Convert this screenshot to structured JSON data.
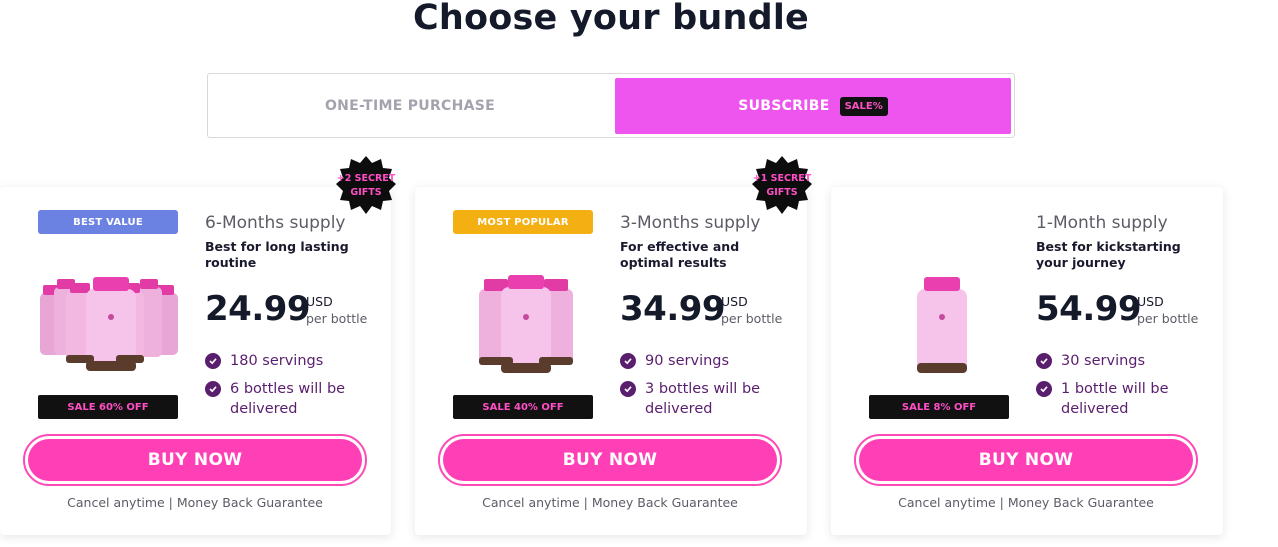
{
  "page": {
    "title": "Choose your bundle"
  },
  "toggle": {
    "one_time_label": "ONE-TIME PURCHASE",
    "subscribe_label": "SUBSCRIBE",
    "sale_badge": "SALE%"
  },
  "colors": {
    "accent_pink": "#ff3fb6",
    "subscribe_bg": "#ee55ee",
    "purple": "#5a1e6e",
    "best_value_blue": "#6b82e3",
    "most_popular_yellow": "#f4b012"
  },
  "bundles": [
    {
      "badge": "BEST VALUE",
      "gifts": "+2 SECRET GIFTS",
      "supply": "6-Months supply",
      "tagline": "Best for long lasting routine",
      "price": "24.99",
      "currency": "USD",
      "per": "per bottle",
      "features": [
        "180 servings",
        "6 bottles will be delivered"
      ],
      "sale": "SALE 60% OFF",
      "button": "BUY NOW",
      "guarantee": "Cancel anytime | Money Back Guarantee"
    },
    {
      "badge": "MOST POPULAR",
      "gifts": "+1 SECRET GIFTS",
      "supply": "3-Months supply",
      "tagline": "For effective and optimal results",
      "price": "34.99",
      "currency": "USD",
      "per": "per bottle",
      "features": [
        "90 servings",
        "3 bottles will be delivered"
      ],
      "sale": "SALE 40% OFF",
      "button": "BUY NOW",
      "guarantee": "Cancel anytime | Money Back Guarantee"
    },
    {
      "supply": "1-Month supply",
      "tagline": "Best for kickstarting your journey",
      "price": "54.99",
      "currency": "USD",
      "per": "per bottle",
      "features": [
        "30 servings",
        "1 bottle will be delivered"
      ],
      "sale": "SALE 8% OFF",
      "button": "BUY NOW",
      "guarantee": "Cancel anytime | Money Back Guarantee"
    }
  ]
}
